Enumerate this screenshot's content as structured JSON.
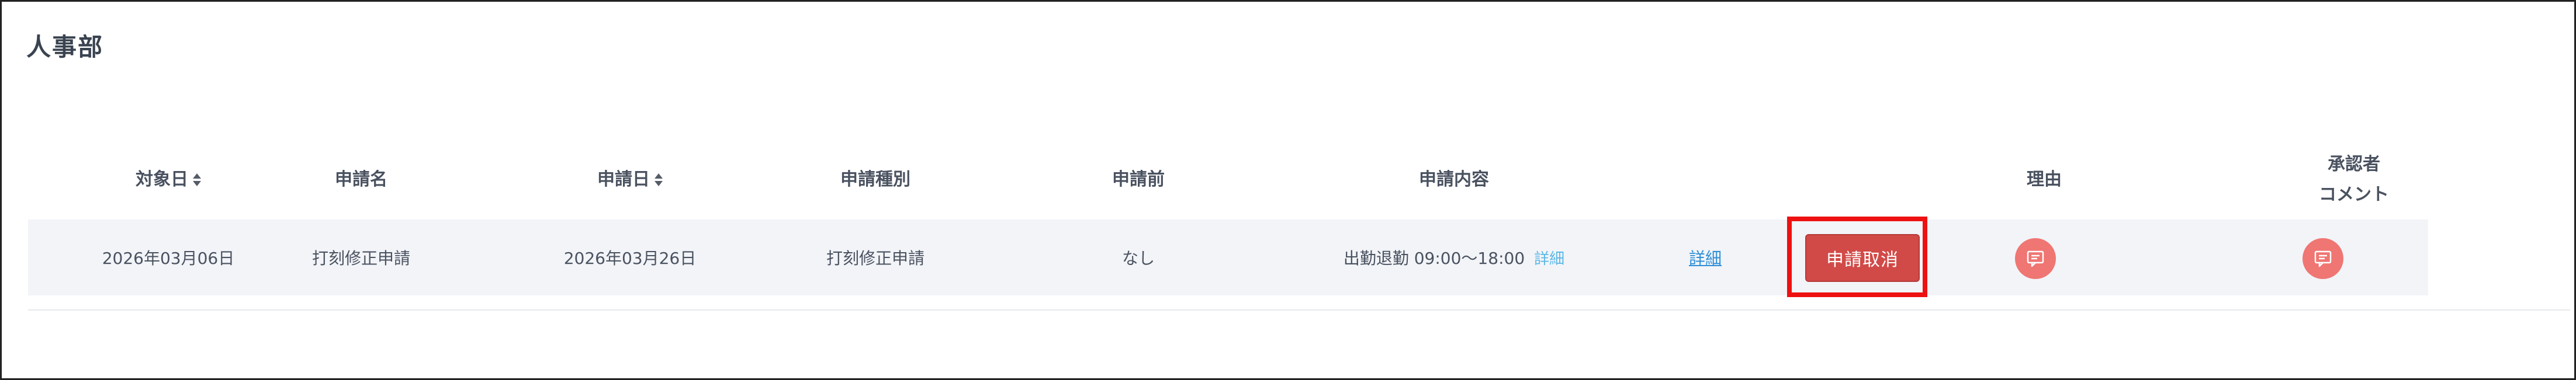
{
  "department": {
    "title": "人事部"
  },
  "table": {
    "headers": {
      "target_date": "対象日",
      "request_name": "申請名",
      "request_date": "申請日",
      "request_type": "申請種別",
      "before": "申請前",
      "content": "申請内容",
      "reason": "理由",
      "approver_comment_line1": "承認者",
      "approver_comment_line2": "コメント"
    },
    "rows": [
      {
        "target_date": "2026年03月06日",
        "request_name": "打刻修正申請",
        "request_date": "2026年03月26日",
        "request_type": "打刻修正申請",
        "before": "なし",
        "content": "出勤退勤 09:00～18:00",
        "content_detail": "詳細",
        "detail_link": "詳細",
        "cancel_label": "申請取消"
      }
    ]
  },
  "icons": {
    "sort": "sort-icon",
    "reason": "comment-icon",
    "approver_comment": "comment-icon"
  },
  "colors": {
    "cancel_button": "#d14a47",
    "icon_button": "#ef7672",
    "link": "#2f8fd8",
    "highlight": "#ee1111",
    "row_bg": "#f2f4f8"
  }
}
